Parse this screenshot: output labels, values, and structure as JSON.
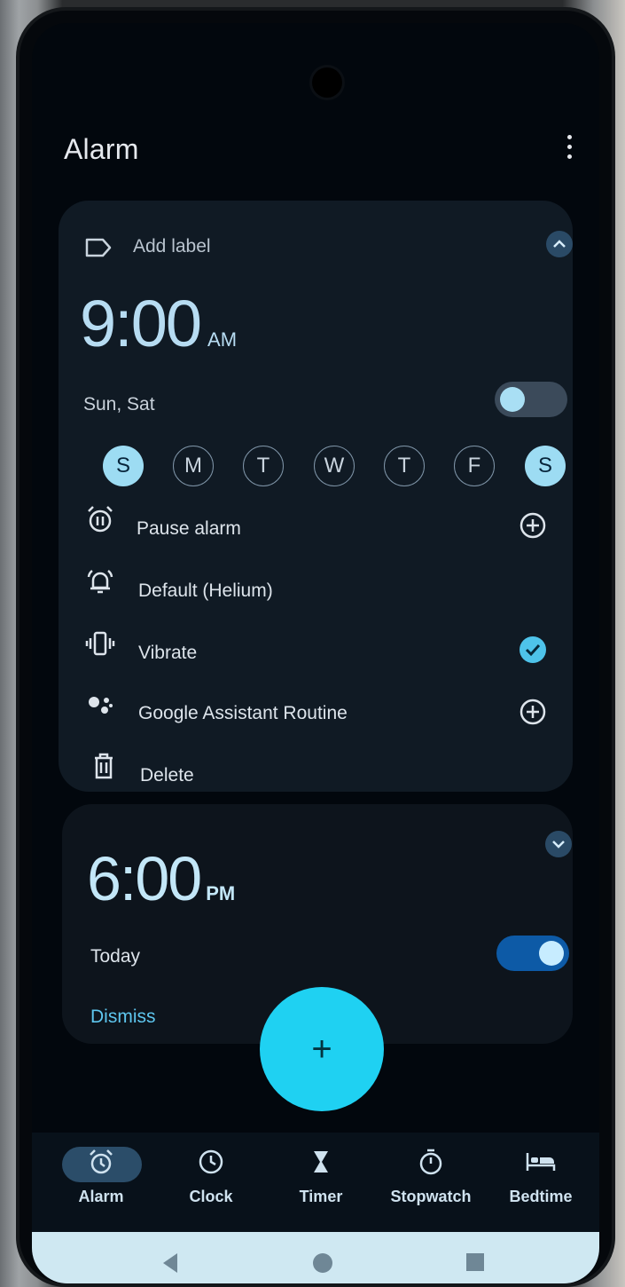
{
  "app": {
    "title": "Alarm"
  },
  "alarm1": {
    "label_placeholder": "Add label",
    "time": "9:00",
    "ampm": "AM",
    "repeat_text": "Sun, Sat",
    "enabled": false,
    "days": [
      {
        "letter": "S",
        "selected": true
      },
      {
        "letter": "M",
        "selected": false
      },
      {
        "letter": "T",
        "selected": false
      },
      {
        "letter": "W",
        "selected": false
      },
      {
        "letter": "T",
        "selected": false
      },
      {
        "letter": "F",
        "selected": false
      },
      {
        "letter": "S",
        "selected": true
      }
    ],
    "options": {
      "pause": "Pause alarm",
      "sound": "Default (Helium)",
      "vibrate": "Vibrate",
      "vibrate_checked": true,
      "assistant": "Google Assistant Routine",
      "delete": "Delete"
    }
  },
  "alarm2": {
    "time": "6:00",
    "ampm": "PM",
    "repeat_text": "Today",
    "enabled": true,
    "dismiss": "Dismiss"
  },
  "fab": {
    "symbol": "+"
  },
  "nav": {
    "items": [
      {
        "label": "Alarm",
        "icon": "alarm-clock-icon",
        "active": true
      },
      {
        "label": "Clock",
        "icon": "clock-icon",
        "active": false
      },
      {
        "label": "Timer",
        "icon": "hourglass-icon",
        "active": false
      },
      {
        "label": "Stopwatch",
        "icon": "stopwatch-icon",
        "active": false
      },
      {
        "label": "Bedtime",
        "icon": "bed-icon",
        "active": false
      }
    ]
  },
  "colors": {
    "accent": "#1fd1f2",
    "card": "#101a24",
    "day_selected": "#9ddcf3",
    "toggle_on": "#0d5aa6"
  }
}
